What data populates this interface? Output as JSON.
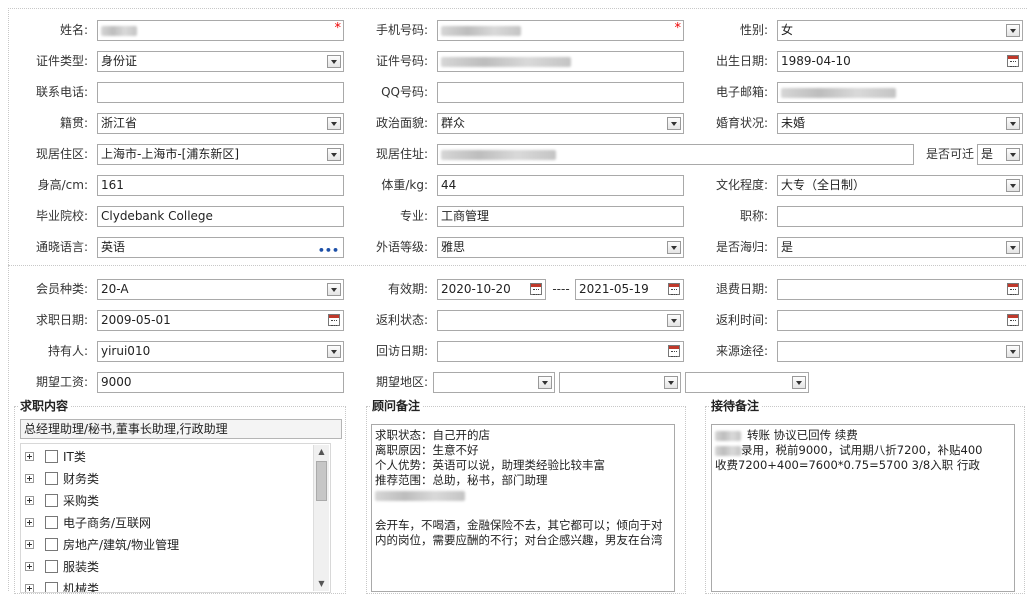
{
  "required_mark": "*",
  "range_sep": "----",
  "fields": {
    "name_label": "姓名:",
    "mobile_label": "手机号码:",
    "gender_label": "性别:",
    "gender_value": "女",
    "id_type_label": "证件类型:",
    "id_type_value": "身份证",
    "id_no_label": "证件号码:",
    "birth_label": "出生日期:",
    "birth_value": "1989-04-10",
    "phone_label": "联系电话:",
    "qq_label": "QQ号码:",
    "email_label": "电子邮箱:",
    "native_label": "籍贯:",
    "native_value": "浙江省",
    "political_label": "政治面貌:",
    "political_value": "群众",
    "marital_label": "婚育状况:",
    "marital_value": "未婚",
    "residence_area_label": "现居住区:",
    "residence_area_value": "上海市-上海市-[浦东新区]",
    "address_label": "现居住址:",
    "transfer_label": "是否可迁",
    "transfer_value": "是",
    "height_label": "身高/cm:",
    "height_value": "161",
    "weight_label": "体重/kg:",
    "weight_value": "44",
    "education_label": "文化程度:",
    "education_value": "大专（全日制）",
    "school_label": "毕业院校:",
    "school_value": "Clydebank College",
    "major_label": "专业:",
    "major_value": "工商管理",
    "title_label": "职称:",
    "language_label": "通晓语言:",
    "language_value": "英语",
    "lang_level_label": "外语等级:",
    "lang_level_value": "雅思",
    "overseas_label": "是否海归:",
    "overseas_value": "是"
  },
  "member": {
    "type_label": "会员种类:",
    "type_value": "20-A",
    "validity_label": "有效期:",
    "validity_from": "2020-10-20",
    "validity_to": "2021-05-19",
    "refund_date_label": "退费日期:",
    "apply_date_label": "求职日期:",
    "apply_date_value": "2009-05-01",
    "rebate_status_label": "返利状态:",
    "rebate_time_label": "返利时间:",
    "holder_label": "持有人:",
    "holder_value": "yirui010",
    "revisit_label": "回访日期:",
    "source_label": "来源途径:",
    "salary_label": "期望工资:",
    "salary_value": "9000",
    "region_label": "期望地区:"
  },
  "job_panel": {
    "title": "求职内容",
    "summary": "总经理助理/秘书,董事长助理,行政助理",
    "tree": [
      "IT类",
      "财务类",
      "采购类",
      "电子商务/互联网",
      "房地产/建筑/物业管理",
      "服装类",
      "机械类"
    ]
  },
  "advisor_panel": {
    "title": "顾问备注",
    "lines": [
      "求职状态：自己开的店",
      "离职原因：生意不好",
      "个人优势：英语可以说，助理类经验比较丰富",
      "推荐范围：总助，秘书，部门助理"
    ],
    "note": "会开车，不喝酒，金融保险不去，其它都可以；倾向于对内的岗位，需要应酬的不行；对台企感兴趣，男友在台湾"
  },
  "reception_panel": {
    "title": "接待备注",
    "line1": "转账 协议已回传 续费",
    "line2": "录用，税前9000，试用期八折7200，补贴400",
    "line3": "收费7200+400=7600*0.75=5700  3/8入职  行政"
  }
}
